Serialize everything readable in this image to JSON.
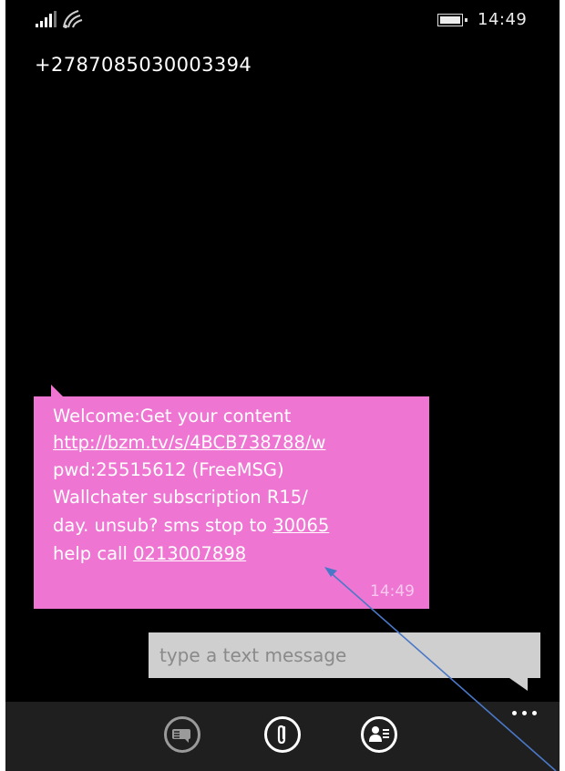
{
  "status": {
    "time": "14:49"
  },
  "conversation": {
    "contact_number": "+2787085030003394"
  },
  "message": {
    "line1": "Welcome:Get your content",
    "link_url": "http://bzm.tv/s/4BCB738788/w",
    "line3": "pwd:25515612 (FreeMSG)",
    "line4": "Wallchater subscription R15/",
    "line5_prefix": "day. unsub? sms stop to ",
    "line5_number": "30065",
    "line6_prefix": "help call ",
    "line6_number": "0213007898",
    "time": "14:49",
    "bubble_color": "#ee76d2"
  },
  "compose": {
    "placeholder": "type a text message"
  },
  "app_bar": {
    "buttons": [
      "switch-sim-icon",
      "attach-icon",
      "contact-icon"
    ],
    "more": "···"
  },
  "annotation": {
    "arrow_color": "#4a78c8"
  }
}
